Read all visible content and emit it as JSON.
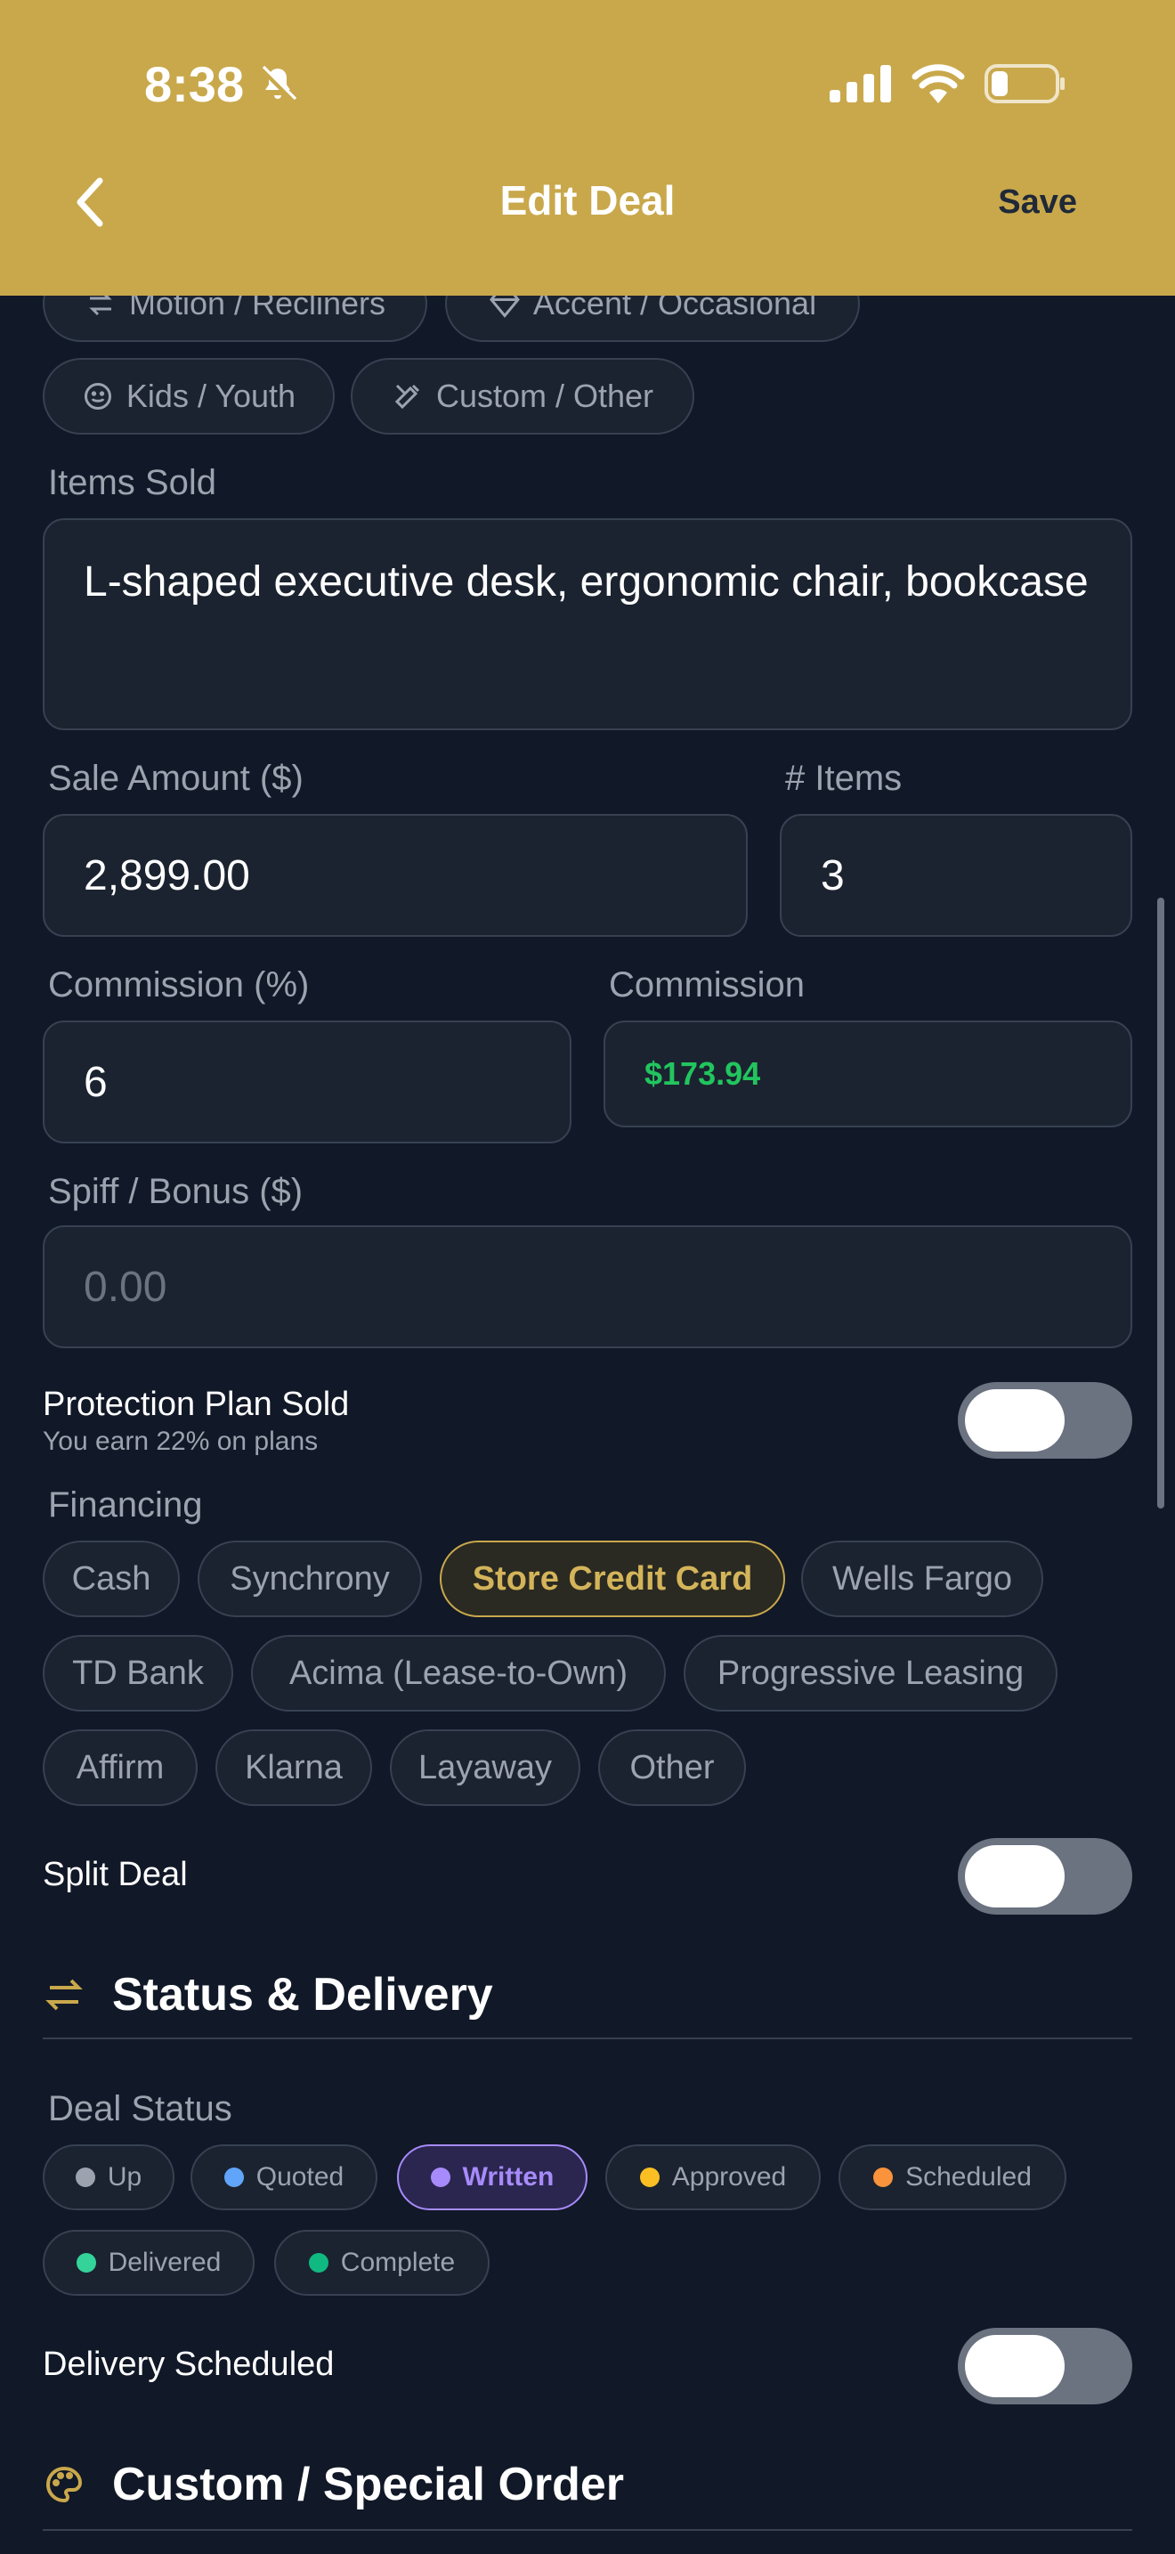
{
  "status_bar": {
    "time": "8:38"
  },
  "nav": {
    "title": "Edit Deal",
    "save_label": "Save"
  },
  "categories": [
    {
      "label": "Motion / Recliners",
      "icon": "arrows-icon"
    },
    {
      "label": "Accent / Occasional",
      "icon": "diamond-icon"
    },
    {
      "label": "Kids / Youth",
      "icon": "smiley-icon"
    },
    {
      "label": "Custom / Other",
      "icon": "tools-icon"
    }
  ],
  "items_sold": {
    "label": "Items Sold",
    "value": "L-shaped executive desk, ergonomic chair, bookcase"
  },
  "sale_amount": {
    "label": "Sale Amount ($)",
    "value": "2,899.00"
  },
  "num_items": {
    "label": "# Items",
    "value": "3"
  },
  "commission_pct": {
    "label": "Commission (%)",
    "value": "6"
  },
  "commission": {
    "label": "Commission",
    "value": "$173.94",
    "color": "#22c55e"
  },
  "spiff": {
    "label": "Spiff / Bonus ($)",
    "placeholder": "0.00"
  },
  "protection_plan": {
    "title": "Protection Plan Sold",
    "subtitle": "You earn 22% on plans"
  },
  "financing": {
    "label": "Financing",
    "options": [
      "Cash",
      "Synchrony",
      "Store Credit Card",
      "Wells Fargo",
      "TD Bank",
      "Acima (Lease-to-Own)",
      "Progressive Leasing",
      "Affirm",
      "Klarna",
      "Layaway",
      "Other"
    ],
    "selected": "Store Credit Card"
  },
  "split_deal": {
    "title": "Split Deal"
  },
  "status_section": {
    "title": "Status & Delivery"
  },
  "deal_status": {
    "label": "Deal Status",
    "options": [
      {
        "label": "Up",
        "color": "#9ca3af"
      },
      {
        "label": "Quoted",
        "color": "#60a5fa"
      },
      {
        "label": "Written",
        "color": "#a78bfa"
      },
      {
        "label": "Approved",
        "color": "#fbbf24"
      },
      {
        "label": "Scheduled",
        "color": "#fb923c"
      },
      {
        "label": "Delivered",
        "color": "#34d399"
      },
      {
        "label": "Complete",
        "color": "#10b981"
      }
    ],
    "selected": "Written"
  },
  "delivery": {
    "title": "Delivery Scheduled"
  },
  "custom_section": {
    "title": "Custom / Special Order"
  },
  "colors": {
    "header": "#c9a84c",
    "background": "#111827",
    "accent_gold": "#c9a84c",
    "accent_purple": "#a78bfa"
  }
}
